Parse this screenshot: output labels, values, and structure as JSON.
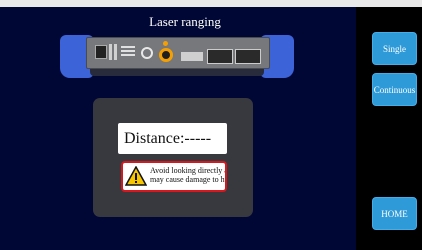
{
  "header": {
    "title": "Laser ranging"
  },
  "device_image": {
    "icon": "laser-rangefinder-device"
  },
  "display": {
    "distance_label": "Distance:-----"
  },
  "warning": {
    "icon": "warning-triangle-icon",
    "line1": "Avoid looking directly at",
    "line2": "may cause damage to hu"
  },
  "sidebar": {
    "single_label": "Single",
    "continuous_label": "Continuous",
    "home_label": "HOME"
  },
  "colors": {
    "background": "#000735",
    "button": "#2e9ad8",
    "warning_border": "#d8161e",
    "panel": "#38383f"
  }
}
